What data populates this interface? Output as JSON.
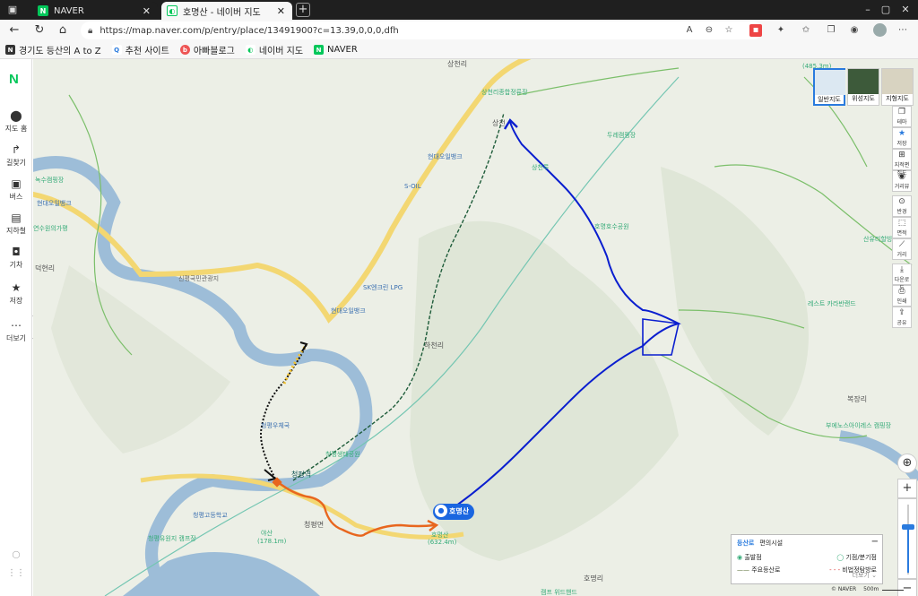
{
  "browser": {
    "tabs": [
      {
        "label": "NAVER",
        "favicon": "naver-icon",
        "active": false
      },
      {
        "label": "호명산 - 네이버 지도",
        "favicon": "naver-map-icon",
        "active": true
      }
    ],
    "url": "https://map.naver.com/p/entry/place/13491900?c=13.39,0,0,0,dfh",
    "bookmarks": [
      {
        "label": "경기도 등산의 A to Z",
        "icon": "bookmark-page-icon"
      },
      {
        "label": "추천 사이트",
        "icon": "search-icon"
      },
      {
        "label": "아빠블로그",
        "icon": "blog-icon"
      },
      {
        "label": "네이버 지도",
        "icon": "naver-map-icon"
      },
      {
        "label": "NAVER",
        "icon": "naver-icon"
      }
    ]
  },
  "rail": {
    "logo": "N",
    "items": [
      {
        "label": "지도 홈",
        "icon": "map-pin-icon"
      },
      {
        "label": "길찾기",
        "icon": "directions-icon"
      },
      {
        "label": "버스",
        "icon": "bus-icon"
      },
      {
        "label": "지하철",
        "icon": "subway-icon"
      },
      {
        "label": "기차",
        "icon": "train-icon"
      },
      {
        "label": "저장",
        "icon": "star-icon"
      },
      {
        "label": "더보기",
        "icon": "more-icon"
      }
    ]
  },
  "map": {
    "maptypes": [
      {
        "label": "일반지도",
        "selected": true
      },
      {
        "label": "위성지도",
        "selected": false
      },
      {
        "label": "지형지도",
        "selected": false
      }
    ],
    "tools": [
      "테마",
      "저장",
      "지적편집도",
      "거리뷰",
      "반경",
      "면적",
      "거리",
      "다운로드",
      "인쇄",
      "공유"
    ],
    "place_labels": {
      "sangcheonri": "상천리",
      "sangcheon_village": "상천리종합정류장",
      "sangcheon_station": "상천",
      "ducheol": "두레캠핑장",
      "sangcheon_ru": "상천루",
      "homyeong_lake": "호명호수공원",
      "hyundai_oil": "현대오일뱅크",
      "soil": "S-OIL",
      "sk_lpg": "SK엔크린 LPG",
      "hyundai_oil2": "현대오일뱅크",
      "hacheonri": "하천리",
      "deokhyeonri": "덕현리",
      "sinpyeong": "신평국민관광지",
      "hyundai_oil3": "현대오일뱅크",
      "yeonsu": "연수원의가평",
      "camping": "녹수캠핑장",
      "cheongpyeong_office": "청평우체국",
      "cheongpyeong_station": "청평역",
      "cheongpyeong_park": "청평생태공원",
      "cheongpyeong_myeon": "청평면",
      "cheongpyeong_school": "청평고등학교",
      "yesan": "야산",
      "yesan_h": "(178.1m)",
      "cheongpyeong_dam": "청평유원지 캠프장",
      "homyeongsan": "호명산",
      "homyeongsan_h": "(632.4m)",
      "homyeongri": "호명리",
      "bokjangri": "복장리",
      "sannaeri": "산유리할빙 골프장",
      "rest": "레스트 카라반랜드",
      "bujaenoseu": "부에노스아이레스 캠핑장",
      "camp_world": "캠프 위드핸드",
      "corner_h": "(485.3m)"
    },
    "peak_label": "호명산",
    "legend": {
      "tab_hiking": "등산로",
      "tab_facility": "편의시설",
      "start": "출발점",
      "branch": "기점/분기점",
      "main_trail": "주요등산로",
      "closed_trail": "비법정탐방로",
      "more": "더보기"
    },
    "attribution": "© NAVER",
    "scale": "500m",
    "zoom_level": 0.65
  },
  "colors": {
    "accent": "#2a7bde",
    "route_blue": "#0a1ecf",
    "route_orange": "#e8661e",
    "naver_green": "#03c75a"
  }
}
